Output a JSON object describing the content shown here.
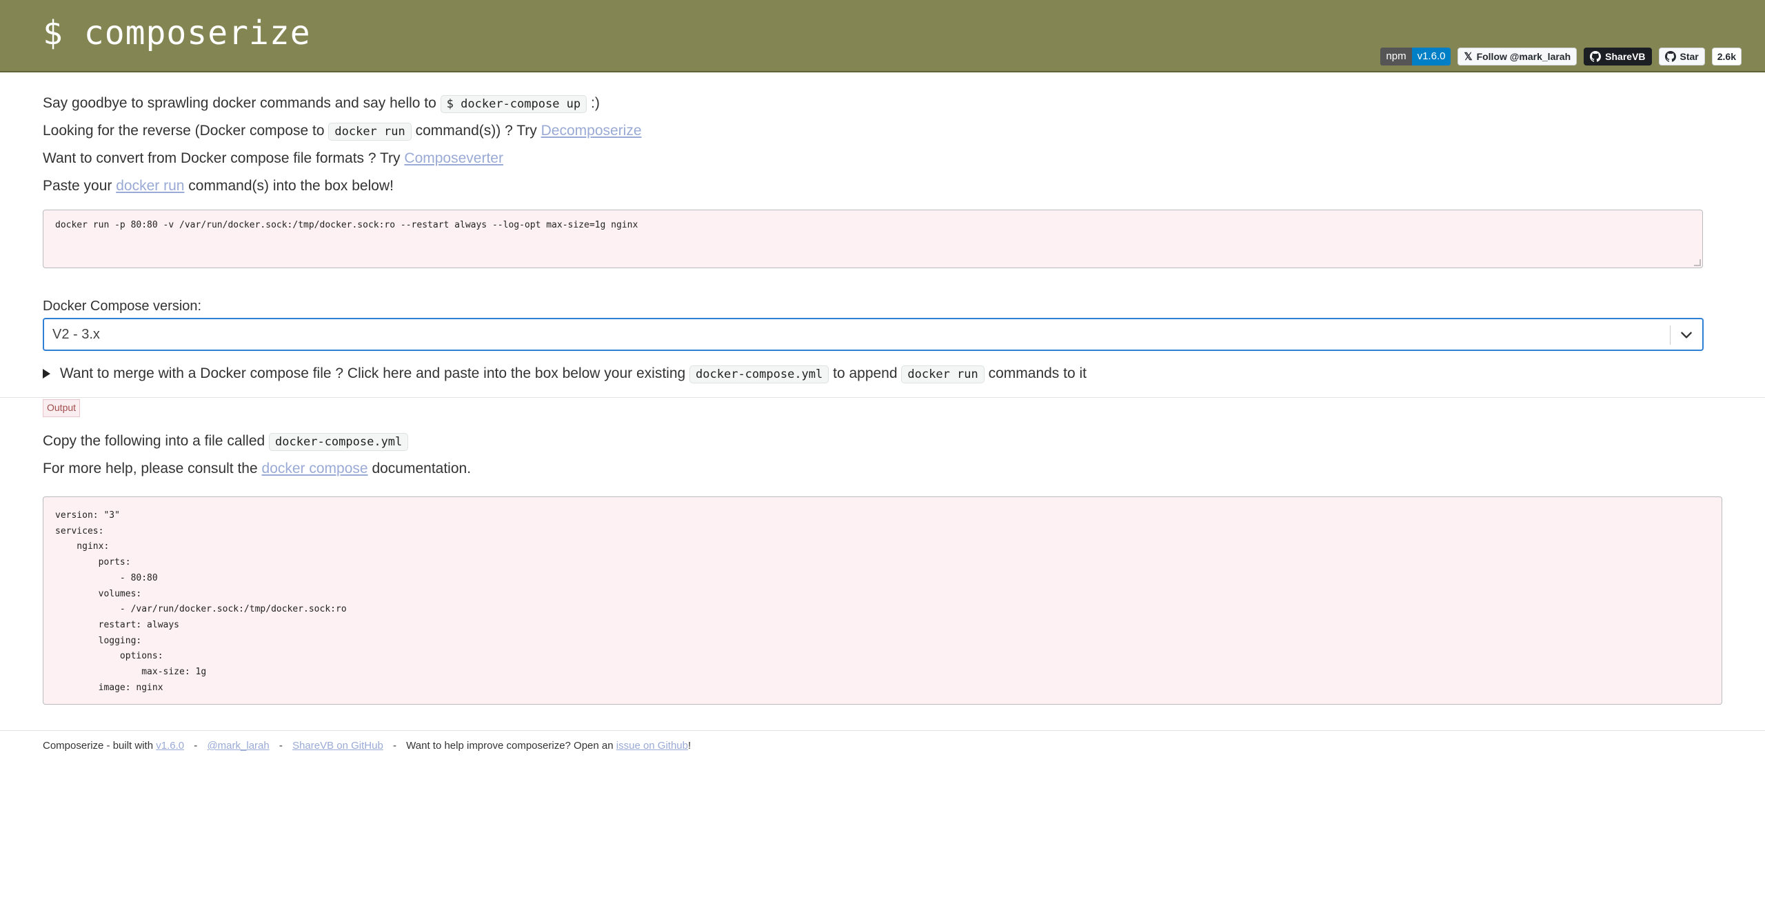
{
  "header": {
    "logo": "$ composerize",
    "badges": {
      "npm_label": "npm",
      "npm_version": "v1.6.0",
      "follow": "Follow @mark_larah",
      "sharevb": "ShareVB",
      "star": "Star",
      "star_count": "2.6k"
    }
  },
  "intro": {
    "line1_pre": "Say goodbye to sprawling docker commands and say hello to",
    "line1_code": "$ docker-compose up",
    "line1_post": ":)",
    "line2_pre": "Looking for the reverse (Docker compose to",
    "line2_code": "docker run",
    "line2_mid": "command(s)) ? Try",
    "line2_link": "Decomposerize",
    "line3_pre": "Want to convert from Docker compose file formats ? Try",
    "line3_link": "Composeverter",
    "line4_pre": "Paste your",
    "line4_link": "docker run",
    "line4_post": "command(s) into the box below!"
  },
  "command_input": {
    "value": "docker run -p 80:80 -v /var/run/docker.sock:/tmp/docker.sock:ro --restart always --log-opt max-size=1g nginx"
  },
  "version_select": {
    "label": "Docker Compose version:",
    "selected": "V2 - 3.x"
  },
  "merge": {
    "pre": "Want to merge with a Docker compose file ? Click here and paste into the box below your existing",
    "code1": "docker-compose.yml",
    "mid": "to append",
    "code2": "docker run",
    "post": "commands to it"
  },
  "output": {
    "tag": "Output",
    "copy_pre": "Copy the following into a file called",
    "copy_code": "docker-compose.yml",
    "help_pre": "For more help, please consult the",
    "help_link": "docker compose",
    "help_post": "documentation.",
    "yaml": "version: \"3\"\nservices:\n    nginx:\n        ports:\n            - 80:80\n        volumes:\n            - /var/run/docker.sock:/tmp/docker.sock:ro\n        restart: always\n        logging:\n            options:\n                max-size: 1g\n        image: nginx"
  },
  "footer": {
    "built": "Composerize - built with",
    "version_link": "v1.6.0",
    "sep": "-",
    "author_link": "@mark_larah",
    "sharevb_link": "ShareVB on GitHub",
    "help_text": "Want to help improve composerize? Open an",
    "issue_link": "issue on Github",
    "end": "!"
  }
}
